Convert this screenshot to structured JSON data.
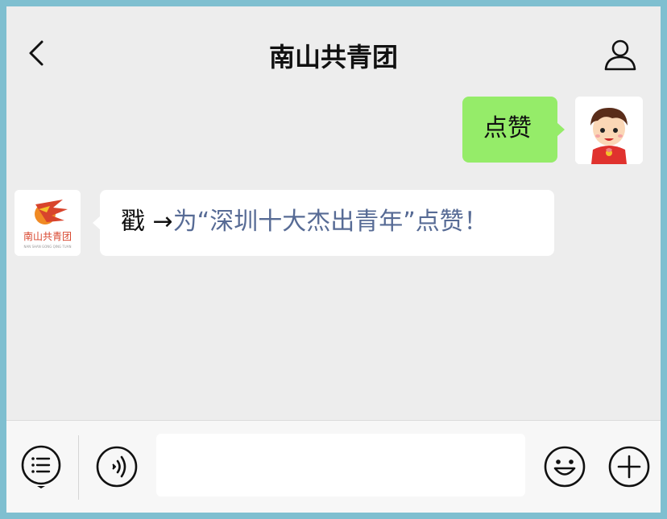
{
  "header": {
    "title": "南山共青团",
    "back_icon": "chevron-left-icon",
    "profile_icon": "person-icon"
  },
  "messages": [
    {
      "sender": "self",
      "text": "点赞",
      "avatar": "cartoon-boy-avatar"
    },
    {
      "sender": "南山共青团",
      "prefix": "戳 →",
      "link_text": "为“深圳十大杰出青年”点赞！",
      "avatar": "nanshan-youth-league-logo"
    }
  ],
  "org_logo": {
    "name": "南山共青团",
    "subtext": "NAN SHAN GONG QING TUAN"
  },
  "bottombar": {
    "menu_icon": "menu-list-icon",
    "voice_icon": "voice-icon",
    "input_value": "",
    "emoji_icon": "emoji-icon",
    "plus_icon": "plus-icon"
  },
  "colors": {
    "self_bubble": "#95ec69",
    "link": "#576b95",
    "background": "#ededed"
  }
}
